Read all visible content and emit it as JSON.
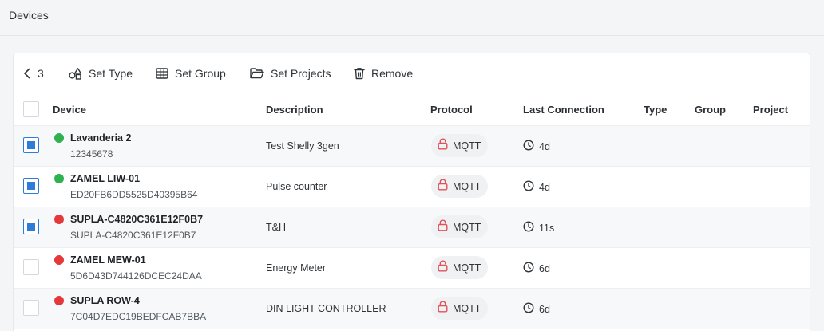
{
  "page": {
    "title": "Devices"
  },
  "toolbar": {
    "selected_count": "3",
    "set_type": "Set Type",
    "set_group": "Set Group",
    "set_projects": "Set Projects",
    "remove": "Remove"
  },
  "table": {
    "columns": {
      "device": "Device",
      "description": "Description",
      "protocol": "Protocol",
      "last_connection": "Last Connection",
      "type": "Type",
      "group": "Group",
      "project": "Project"
    },
    "rows": [
      {
        "name": "Lavanderia 2",
        "id": "12345678",
        "description": "Test Shelly 3gen",
        "protocol": "MQTT",
        "last_connection": "4d",
        "status": "online",
        "selected": true
      },
      {
        "name": "ZAMEL LIW-01",
        "id": "ED20FB6DD5525D40395B64",
        "description": "Pulse counter",
        "protocol": "MQTT",
        "last_connection": "4d",
        "status": "online",
        "selected": true
      },
      {
        "name": "SUPLA-C4820C361E12F0B7",
        "id": "SUPLA-C4820C361E12F0B7",
        "description": "T&H",
        "protocol": "MQTT",
        "last_connection": "11s",
        "status": "offline",
        "selected": true
      },
      {
        "name": "ZAMEL MEW-01",
        "id": "5D6D43D744126DCEC24DAA",
        "description": "Energy Meter",
        "protocol": "MQTT",
        "last_connection": "6d",
        "status": "offline",
        "selected": false
      },
      {
        "name": "SUPLA ROW-4",
        "id": "7C04D7EDC19BEDFCAB7BBA",
        "description": "DIN LIGHT CONTROLLER",
        "protocol": "MQTT",
        "last_connection": "6d",
        "status": "offline",
        "selected": false
      }
    ]
  },
  "colors": {
    "online": "#2fb14f",
    "offline": "#e5383b",
    "accent": "#2f7bd8",
    "lock": "#e0525a"
  },
  "icons": {
    "back": "chevron-left-icon",
    "set_type": "shapes-icon",
    "set_group": "table-grid-icon",
    "set_projects": "folder-open-icon",
    "remove": "trash-icon",
    "protocol": "unlocked-lock-icon",
    "last_connection": "clock-icon"
  }
}
